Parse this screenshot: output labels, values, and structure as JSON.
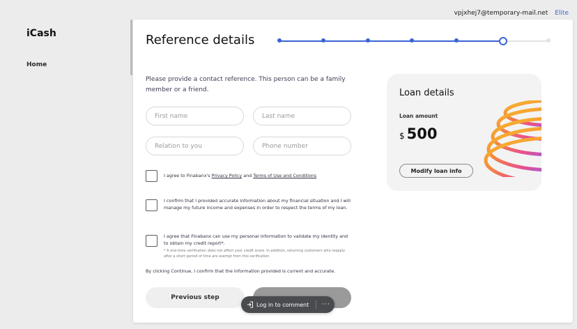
{
  "topbar": {
    "email": "vpjxhej7@temporary-mail.net",
    "plan": "Elite"
  },
  "sidebar": {
    "logo": "iCash",
    "items": [
      {
        "label": "Home"
      }
    ]
  },
  "page": {
    "title": "Reference details",
    "intro": "Please provide a contact reference. This person can be a family member or a friend."
  },
  "stepper": {
    "total_steps": 7,
    "current_step": 6
  },
  "form": {
    "first_name": {
      "placeholder": "First name",
      "value": ""
    },
    "last_name": {
      "placeholder": "Last name",
      "value": ""
    },
    "relation": {
      "placeholder": "Relation to you",
      "value": ""
    },
    "phone": {
      "placeholder": "Phone number",
      "value": ""
    }
  },
  "checks": {
    "terms": {
      "prefix": "I agree to Finabanx's ",
      "privacy_link": "Privacy Policy",
      "and": " and ",
      "terms_link": "Terms of Use and Conditions",
      "checked": false
    },
    "financial": {
      "text": "I confirm that I provided accurate information about my financial situation and I will manage my future income and expenses in order to respect the terms of my loan.",
      "checked": false
    },
    "credit": {
      "text": "I agree that Finabanx can use my personal information to validate my identity and to obtain my credit report*.",
      "note": "* A one-time verification does not affect your credit score. In addition, returning customers who reapply after a short period of time are exempt from this verification",
      "checked": false
    }
  },
  "confirm_text": "By clicking Continue, I confirm that the information provided is current and accurate.",
  "buttons": {
    "previous": "Previous step"
  },
  "loan": {
    "title": "Loan details",
    "amount_label": "Loan amount",
    "currency": "$",
    "amount": "500",
    "modify": "Modify loan info"
  },
  "comment_bar": {
    "label": "Log in to comment",
    "more": "···"
  },
  "colors": {
    "accent": "#3a63d6",
    "background": "#ececec",
    "card": "#ffffff"
  }
}
